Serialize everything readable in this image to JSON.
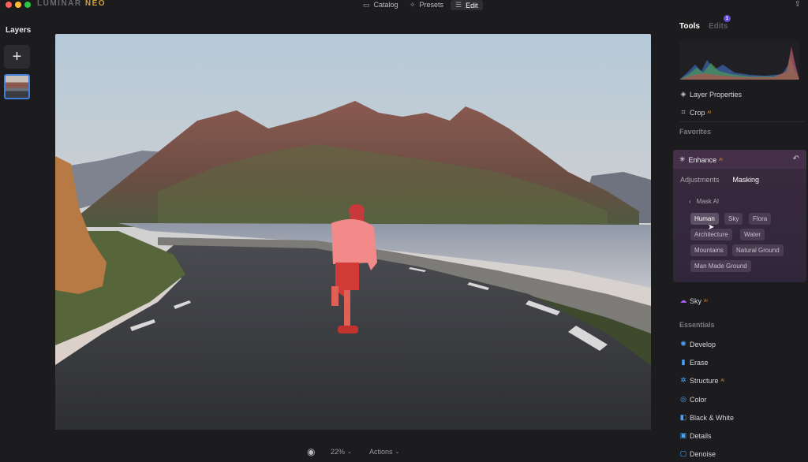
{
  "app": {
    "brand_main": "LUMINAR",
    "brand_accent": "NEO"
  },
  "nav": {
    "catalog": "Catalog",
    "presets": "Presets",
    "edit": "Edit"
  },
  "left": {
    "layers_title": "Layers",
    "add_symbol": "+"
  },
  "bottom": {
    "zoom": "22%",
    "actions": "Actions"
  },
  "right": {
    "tab_tools": "Tools",
    "tab_edits": "Edits",
    "edits_badge": "1",
    "layer_properties": "Layer Properties",
    "crop": "Crop",
    "favorites": "Favorites",
    "enhance": "Enhance",
    "ai_badge": "AI",
    "sub_adjustments": "Adjustments",
    "sub_masking": "Masking",
    "mask_ai": "Mask AI",
    "chips": [
      "Human",
      "Sky",
      "Flora",
      "Architecture",
      "Water",
      "Mountains",
      "Natural Ground",
      "Man Made Ground"
    ],
    "active_chip": "Human",
    "sky": "Sky",
    "essentials": "Essentials",
    "tools": [
      "Develop",
      "Erase",
      "Structure",
      "Color",
      "Black & White",
      "Details",
      "Denoise"
    ]
  },
  "colors": {
    "accent_blue": "#3f7fd9",
    "ai_orange": "#d9882a",
    "enhance_purple": "#45304a",
    "mask_red": "#e8553f"
  },
  "icons": {
    "catalog": "folder-icon",
    "presets": "sparkle-icon",
    "edit": "sliders-icon",
    "share": "share-icon",
    "eye": "eye-icon",
    "reset": "undo-icon"
  }
}
